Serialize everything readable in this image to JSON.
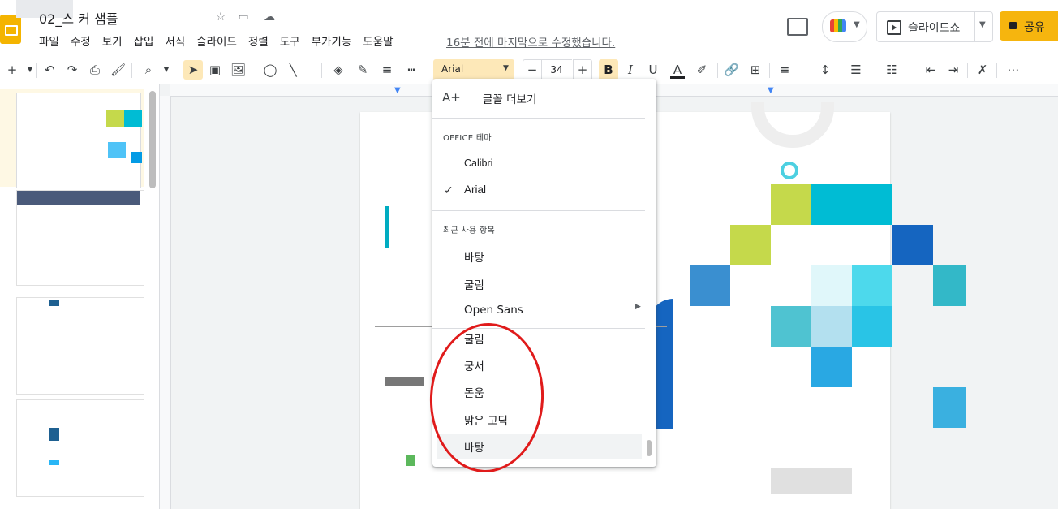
{
  "header": {
    "doc_title": "02_스      커 샘플",
    "menu": [
      "파일",
      "수정",
      "보기",
      "삽입",
      "서식",
      "슬라이드",
      "정렬",
      "도구",
      "부가기능",
      "도움말"
    ],
    "last_edit": "16분 전에 마지막으로 수정했습니다.",
    "slideshow_label": "슬라이드쇼",
    "share_label": "공유"
  },
  "toolbar": {
    "font_value": "Arial",
    "font_size": "34",
    "bold": "B",
    "italic": "I",
    "underline": "U",
    "text_color": "A"
  },
  "font_menu": {
    "more_fonts": "글꼴 더보기",
    "section_theme": "OFFICE 테마",
    "theme_fonts": [
      "Calibri",
      "Arial"
    ],
    "selected_font": "Arial",
    "section_recent": "최근 사용 항목",
    "recent_fonts": [
      "바탕",
      "굴림",
      "Open Sans"
    ],
    "all_fonts": [
      "굴림",
      "궁서",
      "돋움",
      "맑은 고딕",
      "바탕"
    ]
  },
  "colors": {
    "accent": "#f6b50e",
    "highlight": "#fde8b8",
    "annotation": "#e01b1b"
  }
}
